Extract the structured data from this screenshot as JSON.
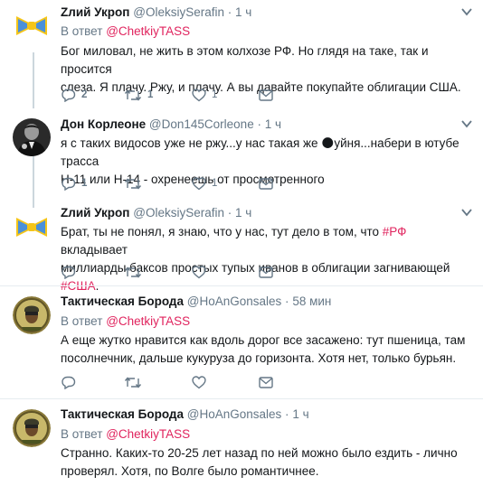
{
  "tweets": [
    {
      "name": "Zлий Укроп",
      "handle": "@OleksiySerafin",
      "dot": "·",
      "time": "1 ч",
      "reply_prefix": "В ответ",
      "reply_to": "@ChetkiyTASS",
      "text_lines": [
        "Бог миловал, не жить в этом колхозе РФ. Но глядя на таке, так и просится",
        "слеза. Я плачу. Ржу, и плачу. А вы давайте покупайте облигации США."
      ],
      "reply_count": "2",
      "retweet_count": "1",
      "like_count": "1"
    },
    {
      "name": "Дон Корлеоне",
      "handle": "@Don145Corleone",
      "dot": "·",
      "time": "1 ч",
      "text_lines": [
        "я с таких видосов уже не ржу...у нас такая же 🌑уйня...набери в ютубе трасса",
        "Н-11 или Н-14 - охренеешь от просмотренного"
      ],
      "reply_count": "1",
      "retweet_count": "",
      "like_count": "1"
    },
    {
      "name": "Zлий Укроп",
      "handle": "@OleksiySerafin",
      "dot": "·",
      "time": "1 ч",
      "text_line1_a": "Брат, ты не понял, я знаю, что у нас, тут дело в том, что ",
      "text_line1_hash": "#РФ",
      "text_line1_b": " вкладывает",
      "text_line2_a": "миллиарды баксов простых тупых иванов в облигации загнивающей ",
      "text_line2_hash": "#США",
      "text_line2_b": ".",
      "reply_count": "",
      "retweet_count": "",
      "like_count": ""
    },
    {
      "name": "Тактическая Борода",
      "handle": "@HoAnGonsales",
      "dot": "·",
      "time": "58 мин",
      "reply_prefix": "В ответ",
      "reply_to": "@ChetkiyTASS",
      "text_lines": [
        "А еще жутко нравится как вдоль дорог все засажено: тут пшеница, там",
        "посолнечник, дальше кукуруза до горизонта. Хотя нет, только бурьян."
      ],
      "reply_count": "",
      "retweet_count": "",
      "like_count": ""
    },
    {
      "name": "Тактическая Борода",
      "handle": "@HoAnGonsales",
      "dot": "·",
      "time": "1 ч",
      "reply_prefix": "В ответ",
      "reply_to": "@ChetkiyTASS",
      "text_lines": [
        "Странно. Каких-то 20-25 лет назад по ней можно было ездить - лично",
        "проверял. Хотя, по Волге было романтичнее."
      ]
    }
  ],
  "icons": {
    "reply": "reply-icon",
    "retweet": "retweet-icon",
    "like": "heart-icon",
    "dm": "envelope-icon",
    "menu": "chevron-down-icon"
  },
  "colors": {
    "accent": "#e0245e",
    "muted": "#657786",
    "divider": "#e6ecf0",
    "text": "#14171a"
  }
}
